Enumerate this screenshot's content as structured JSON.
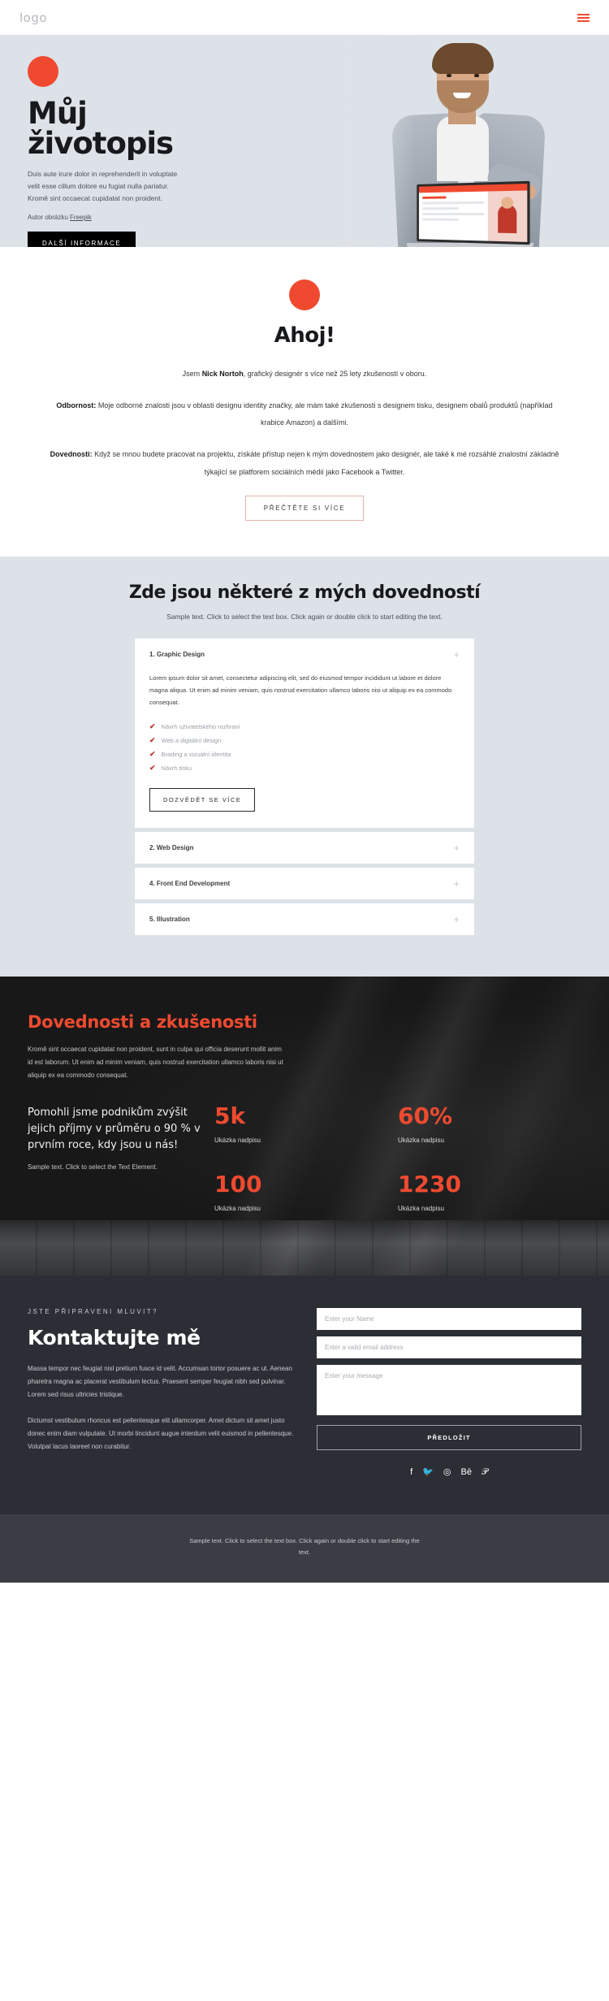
{
  "nav": {
    "logo": "logo",
    "menu_icon": "hamburger-icon"
  },
  "hero": {
    "title_line1": "Můj",
    "title_line2": "životopis",
    "paragraph": "Duis aute irure dolor in reprehenderit in voluptate velit esse cillum dolore eu fugiat nulla pariatur. Kromě sint occaecat cupidatat non proident.",
    "credit_prefix": "Autor obrázku ",
    "credit_link": "Freepik",
    "cta": "DALŠÍ INFORMACE"
  },
  "about": {
    "title": "Ahoj!",
    "p1_pre": "Jsem ",
    "p1_bold": "Nick Nortoh",
    "p1_post": ", grafický designér s více než 25 lety zkušeností v oboru.",
    "p2_bold": "Odbornost:",
    "p2_text": " Moje odborné znalosti jsou v oblasti designu identity značky, ale mám také zkušenosti s designem tisku, designem obalů produktů (například krabice Amazon) a dalšími.",
    "p3_bold": "Dovednosti:",
    "p3_text": " Když se mnou budete pracovat na projektu, získáte přístup nejen k mým dovednostem jako designér, ale také k mé rozsáhlé znalostní základně týkající se platforem sociálních médií jako Facebook a Twitter.",
    "cta": "PŘEČTĚTE SI VÍCE"
  },
  "skills": {
    "title": "Zde jsou některé z mých dovedností",
    "subtitle": "Sample text. Click to select the text box. Click again or double click to start editing the text.",
    "items": [
      {
        "label": "1. Graphic Design",
        "plus": "+",
        "body": "Lorem ipsum dolor sit amet, consectetur adipiscing elit, sed do eiusmod tempor incididunt ut labore et dolore magna aliqua. Ut enim ad minim veniam, quis nostrud exercitation ullamco laboris nisi ut aliquip ex ea commodo consequat.",
        "list": [
          "Návrh uživatelského rozhraní",
          "Web a digitální design",
          "Brading a vizuální identita",
          "Návrh tisku"
        ],
        "cta": "DOZVĚDĚT SE VÍCE"
      },
      {
        "label": "2. Web Design",
        "plus": "+"
      },
      {
        "label": "4. Front End Development",
        "plus": "+"
      },
      {
        "label": "5. Illustration",
        "plus": "+"
      }
    ]
  },
  "experience": {
    "title": "Dovednosti a zkušenosti",
    "paragraph": "Kromě sint occaecat cupidatat non proident, sunt in culpa qui officia deserunt mollit anim id est laborum. Ut enim ad minim veniam, quis nostrud exercitation ullamco laboris nisi ut aliquip ex ea commodo consequat.",
    "lead": "Pomohli jsme podnikům zvýšit jejich příjmy v průměru o 90 % v prvním roce, kdy jsou u nás!",
    "note": "Sample text. Click to select the Text Element.",
    "stats": [
      {
        "value": "5k",
        "caption": "Ukázka nadpisu"
      },
      {
        "value": "60%",
        "caption": "Ukázka nadpisu"
      },
      {
        "value": "100",
        "caption": "Ukázka nadpisu"
      },
      {
        "value": "1230",
        "caption": "Ukázka nadpisu"
      }
    ]
  },
  "contact": {
    "eyebrow": "JSTE PŘIPRAVENI MLUVIT?",
    "title": "Kontaktujte mě",
    "p1": "Massa tempor nec feugiat nisl pretium fusce id velit. Accumsan tortor posuere ac ut. Aenean pharetra magna ac placerat vestibulum lectus. Praesent semper feugiat nibh sed pulvinar. Lorem sed risus ultricies tristique.",
    "p2": "Dictumst vestibulum rhoncus est pellentesque elit ullamcorper. Amet dictum sit amet justo donec enim diam vulputate. Ut morbi tincidunt augue interdum velit euismod in pellentesque. Volutpat lacus laoreet non curabitur.",
    "name_placeholder": "Enter your Name",
    "email_placeholder": "Enter a valid email address",
    "message_placeholder": "Enter your message",
    "submit": "PŘEDLOŽIT",
    "socials": [
      "f",
      "🐦",
      "◎",
      "Bē",
      "𝒫"
    ]
  },
  "footer": {
    "text": "Sample text. Click to select the text box. Click again or double click to start editing the text."
  },
  "colors": {
    "accent": "#ef4a30",
    "hero_bg": "#dde1e8",
    "dark_bg": "#181818",
    "contact_bg": "#2b2f35",
    "footer_bg": "#3a3e44"
  }
}
